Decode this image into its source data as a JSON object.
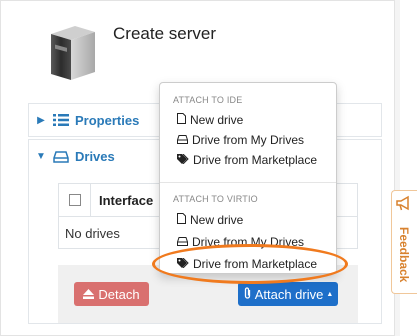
{
  "page": {
    "title": "Create server"
  },
  "sections": {
    "properties": {
      "label": "Properties"
    },
    "drives": {
      "label": "Drives"
    }
  },
  "table": {
    "header": "Interface",
    "empty_text": "No drives"
  },
  "buttons": {
    "detach": "Detach",
    "attach": "Attach drive"
  },
  "dropdown": {
    "ide_header": "ATTACH TO IDE",
    "ide_items": [
      {
        "label": "New drive",
        "icon": "file-icon"
      },
      {
        "label": "Drive from My Drives",
        "icon": "hdd-icon"
      },
      {
        "label": "Drive from Marketplace",
        "icon": "tag-icon"
      }
    ],
    "virtio_header": "ATTACH TO VIRTIO",
    "virtio_items": [
      {
        "label": "New drive",
        "icon": "file-icon"
      },
      {
        "label": "Drive from My Drives",
        "icon": "hdd-icon"
      },
      {
        "label": "Drive from Marketplace",
        "icon": "tag-icon"
      }
    ]
  },
  "feedback": {
    "label": "Feedback"
  },
  "colors": {
    "accent": "#2a7ab8",
    "attach_button": "#1e6fc9",
    "detach_button": "#d9706f",
    "highlight": "#f07a1e",
    "feedback": "#d8822f"
  }
}
